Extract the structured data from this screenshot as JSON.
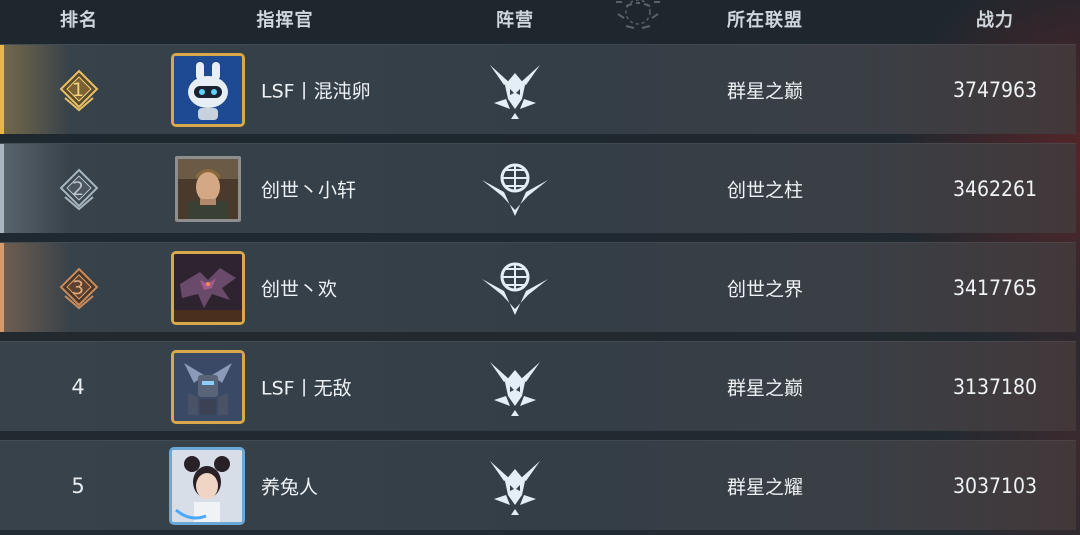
{
  "header": {
    "rank": "排名",
    "commander": "指挥官",
    "faction": "阵营",
    "alliance": "所在联盟",
    "power": "战力"
  },
  "colors": {
    "gold": "#e8b64a",
    "silver": "#9aa8b4",
    "bronze": "#c98a5a",
    "text": "#eef2f5"
  },
  "rows": [
    {
      "rank": "1",
      "commander": "LSF丨混沌卵",
      "faction_icon": "horned-skull-icon",
      "alliance": "群星之巅",
      "power": "3747963",
      "avatar": "robot-avatar"
    },
    {
      "rank": "2",
      "commander": "创世丶小轩",
      "faction_icon": "winged-globe-icon",
      "alliance": "创世之柱",
      "power": "3462261",
      "avatar": "soldier-avatar"
    },
    {
      "rank": "3",
      "commander": "创世丶欢",
      "faction_icon": "winged-globe-icon",
      "alliance": "创世之界",
      "power": "3417765",
      "avatar": "dragon-avatar"
    },
    {
      "rank": "4",
      "commander": "LSF丨无敌",
      "faction_icon": "horned-skull-icon",
      "alliance": "群星之巅",
      "power": "3137180",
      "avatar": "mech-avatar"
    },
    {
      "rank": "5",
      "commander": "养兔人",
      "faction_icon": "horned-skull-icon",
      "alliance": "群星之耀",
      "power": "3037103",
      "avatar": "girl-avatar"
    }
  ]
}
